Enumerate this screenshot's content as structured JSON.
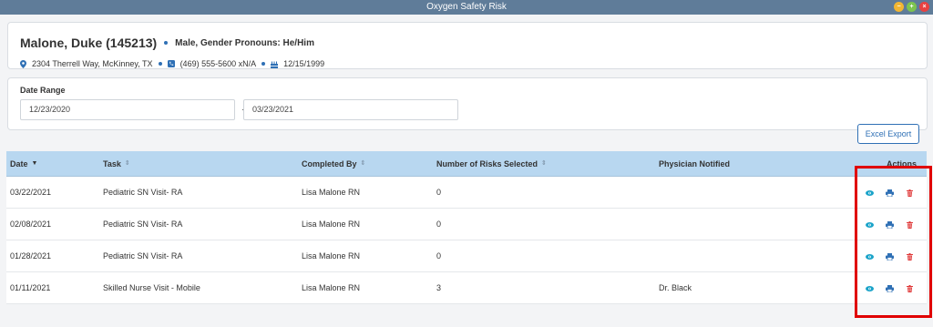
{
  "window": {
    "title": "Oxygen Safety Risk",
    "buttons": [
      "−",
      "+",
      "×"
    ]
  },
  "patient": {
    "name": "Malone, Duke (145213)",
    "gender": "Male, Gender Pronouns: He/Him",
    "address": "2304 Therrell Way, McKinney, TX",
    "phone": "(469) 555-5600 xN/A",
    "dob": "12/15/1999"
  },
  "date_range": {
    "label": "Date Range",
    "start": "12/23/2020",
    "end": "03/23/2021"
  },
  "toolbar": {
    "export_label": "Excel Export"
  },
  "table": {
    "columns": {
      "date": "Date",
      "task": "Task",
      "completed_by": "Completed By",
      "risks": "Number of Risks Selected",
      "physician": "Physician Notified",
      "actions": "Actions"
    },
    "rows": [
      {
        "date": "03/22/2021",
        "task": "Pediatric SN Visit- RA",
        "completed_by": "Lisa Malone RN",
        "risks": "0",
        "physician": ""
      },
      {
        "date": "02/08/2021",
        "task": "Pediatric SN Visit- RA",
        "completed_by": "Lisa Malone RN",
        "risks": "0",
        "physician": ""
      },
      {
        "date": "01/28/2021",
        "task": "Pediatric SN Visit- RA",
        "completed_by": "Lisa Malone RN",
        "risks": "0",
        "physician": ""
      },
      {
        "date": "01/11/2021",
        "task": "Skilled Nurse Visit - Mobile",
        "completed_by": "Lisa Malone RN",
        "risks": "3",
        "physician": "Dr. Black"
      }
    ]
  },
  "colors": {
    "accent": "#2f70b5",
    "view": "#1aa3c9",
    "print": "#2f70b5",
    "delete": "#e03a3a",
    "highlight": "#e00000",
    "header_bg": "#b8d7f0"
  }
}
